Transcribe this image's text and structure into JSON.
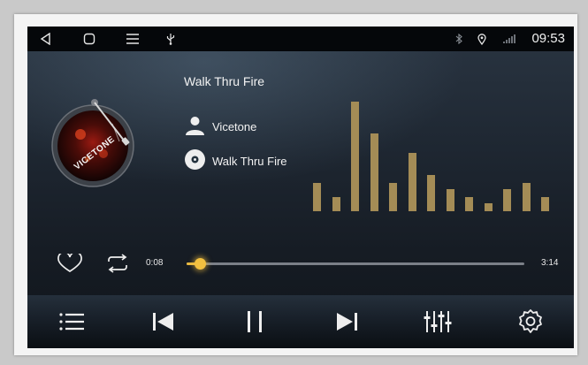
{
  "status_bar": {
    "time": "09:53",
    "icons": [
      "back-icon",
      "home-icon",
      "menu-icon",
      "usb-icon",
      "bluetooth-icon",
      "location-icon",
      "signal-icon"
    ]
  },
  "track": {
    "title": "Walk Thru Fire",
    "artist": "Vicetone",
    "album": "Walk Thru Fire",
    "album_art_text": "VICETONE"
  },
  "equalizer": {
    "levels": [
      0.26,
      0.13,
      1.0,
      0.71,
      0.26,
      0.53,
      0.33,
      0.2,
      0.13,
      0.07,
      0.2,
      0.26,
      0.13
    ],
    "color": "#a48c56"
  },
  "playback": {
    "elapsed": "0:08",
    "total": "3:14",
    "progress": 0.04,
    "accent": "#f2c040"
  },
  "controls": [
    "playlist-icon",
    "previous-icon",
    "pause-icon",
    "next-icon",
    "equalizer-icon",
    "settings-icon"
  ]
}
